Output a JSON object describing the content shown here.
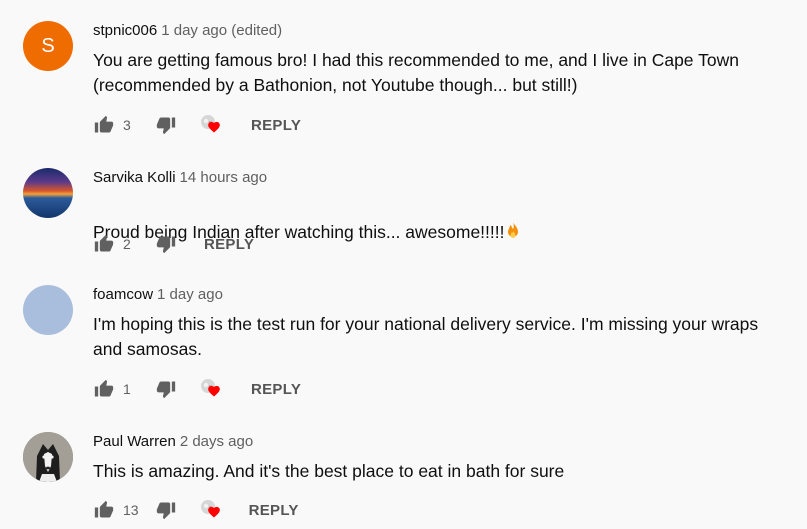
{
  "colors": {
    "background": "#f9f9f9",
    "avatar_orange": "#ef6c00",
    "heart": "#ff0000",
    "icon": "#606060"
  },
  "icons": {
    "like": "thumb-up-icon",
    "dislike": "thumb-down-icon",
    "heart": "creator-heart-icon",
    "emoji": "fire-emoji"
  },
  "comments": [
    {
      "avatar_letter": "S",
      "author": "stpnic006",
      "time": "1 day ago (edited)",
      "text": "You are getting famous bro! I had this recommended to me, and I live in Cape Town\n(recommended by a Bathonion, not Youtube though... but still!)",
      "likes": "3",
      "hearted": true,
      "reply_label": "REPLY"
    },
    {
      "author": "Sarvika Kolli",
      "time": "14 hours ago",
      "text": "Proud being Indian after watching this... awesome!!!!!",
      "likes": "2",
      "hearted": false,
      "reply_label": "REPLY"
    },
    {
      "author": "foamcow",
      "time": "1 day ago",
      "text": "I'm hoping this is the test run for your national delivery service. I'm missing your wraps\nand samosas.",
      "likes": "1",
      "hearted": true,
      "reply_label": "REPLY"
    },
    {
      "author": "Paul Warren",
      "time": "2 days ago",
      "text": "This is amazing. And it's the best place to eat in bath for sure",
      "likes": "13",
      "hearted": true,
      "reply_label": "REPLY"
    }
  ]
}
